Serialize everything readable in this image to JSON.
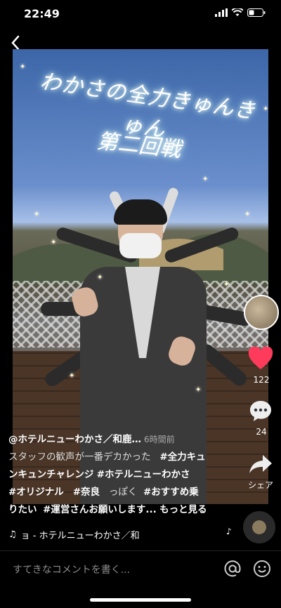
{
  "status": {
    "time": "22:49"
  },
  "video": {
    "overlay_title": "わかさの全力きゅんきゅん",
    "overlay_sub": "第二回戦"
  },
  "actions": {
    "likes": "122",
    "comments": "24",
    "share_label": "シェア"
  },
  "caption": {
    "username": "@ホテルニューわかさ／和鹿…",
    "time_ago": "6時間前",
    "description": "スタッフの歓声が一番デカかった",
    "hashtags": [
      "#全力キュンキュンチャレンジ",
      "#ホテルニューわかさ",
      "#オリジナル",
      "#奈良",
      "#おすすめ乗りたい",
      "#運営さんお願いします..."
    ],
    "hashtag_line1": "#全力キュ",
    "hashtag_line2a": "ンキュンチャレンジ",
    "hashtag_line2b": "#ホテルニューわかさ",
    "hashtag_line3a": "#オリジナル",
    "hashtag_line3b": "#奈良",
    "hashtag_line3c": "っぽく",
    "hashtag_line3d": "#おすすめ乗",
    "hashtag_line4a": "りたい",
    "hashtag_line4b": "#運営さんお願いします...",
    "more_label": "もっと見る"
  },
  "music": {
    "text": "ョ - ホテルニューわかさ／和"
  },
  "comment_bar": {
    "placeholder": "すてきなコメントを書く..."
  },
  "colors": {
    "heart": "#ff3b5c",
    "background": "#000000"
  }
}
